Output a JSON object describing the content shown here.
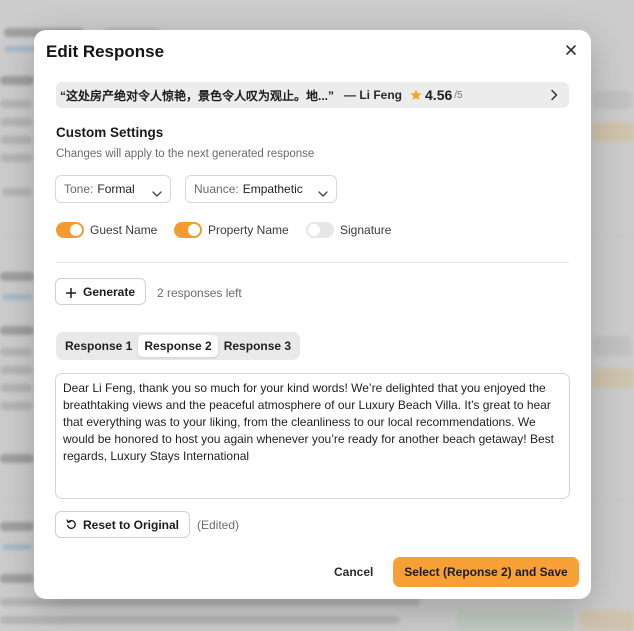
{
  "modal": {
    "title": "Edit Response",
    "close_icon": "close-icon"
  },
  "review": {
    "quote": "“这处房产绝对令人惊艳，景色令人叹为观止。地...”",
    "author": "— Li Feng",
    "score": "4.56",
    "max": "/5",
    "star_color": "#f5a623"
  },
  "settings": {
    "title": "Custom Settings",
    "subtitle": "Changes will apply to the next generated response",
    "tone": {
      "label": "Tone:",
      "value": "Formal"
    },
    "nuance": {
      "label": "Nuance:",
      "value": "Empathetic"
    },
    "toggles": [
      {
        "label": "Guest Name",
        "on": true
      },
      {
        "label": "Property Name",
        "on": true
      },
      {
        "label": "Signature",
        "on": false
      }
    ]
  },
  "generate": {
    "button_label": "Generate",
    "remaining": "2 responses left"
  },
  "tabs": [
    {
      "label": "Response 1",
      "active": false
    },
    {
      "label": "Response 2",
      "active": true
    },
    {
      "label": "Response 3",
      "active": false
    }
  ],
  "response_text": "Dear Li Feng, thank you so much for your kind words! We’re delighted that you enjoyed the breathtaking views and the peaceful atmosphere of our Luxury Beach Villa. It’s great to hear that everything was to your liking, from the cleanliness to our local recommendations. We would be honored to host you again whenever you’re ready for another beach getaway! Best regards, Luxury Stays International",
  "reset": {
    "button_label": "Reset to Original",
    "status": "(Edited)"
  },
  "footer": {
    "cancel_label": "Cancel",
    "save_label": "Select (Reponse 2) and Save"
  },
  "colors": {
    "accent": "#f7a036",
    "toggle_on": "#f39b2f",
    "toggle_off": "#e6e6e6"
  }
}
